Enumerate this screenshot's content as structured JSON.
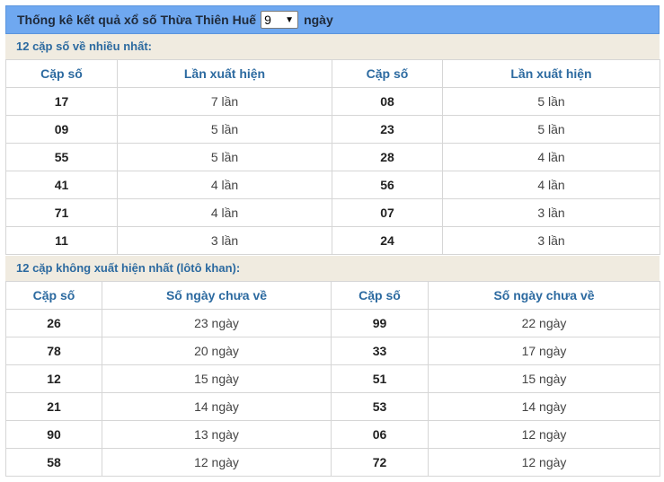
{
  "header": {
    "title": "Thống kê kết quả xổ số Thừa Thiên Huế",
    "select_value": "9",
    "suffix": "ngày"
  },
  "section1": {
    "title": "12 cặp số về nhiều nhất:",
    "headers": [
      "Cặp số",
      "Lần xuất hiện",
      "Cặp số",
      "Lần xuất hiện"
    ],
    "rows": [
      [
        "17",
        "7 lần",
        "08",
        "5 lần"
      ],
      [
        "09",
        "5 lần",
        "23",
        "5 lần"
      ],
      [
        "55",
        "5 lần",
        "28",
        "4 lần"
      ],
      [
        "41",
        "4 lần",
        "56",
        "4 lần"
      ],
      [
        "71",
        "4 lần",
        "07",
        "3 lần"
      ],
      [
        "11",
        "3 lần",
        "24",
        "3 lần"
      ]
    ]
  },
  "section2": {
    "title": "12 cặp không xuất hiện nhất (lôtô khan):",
    "headers": [
      "Cặp số",
      "Số ngày chưa về",
      "Cặp số",
      "Số ngày chưa về"
    ],
    "rows": [
      [
        "26",
        "23 ngày",
        "99",
        "22 ngày"
      ],
      [
        "78",
        "20 ngày",
        "33",
        "17 ngày"
      ],
      [
        "12",
        "15 ngày",
        "51",
        "15 ngày"
      ],
      [
        "21",
        "14 ngày",
        "53",
        "14 ngày"
      ],
      [
        "90",
        "13 ngày",
        "06",
        "12 ngày"
      ],
      [
        "58",
        "12 ngày",
        "72",
        "12 ngày"
      ]
    ]
  }
}
